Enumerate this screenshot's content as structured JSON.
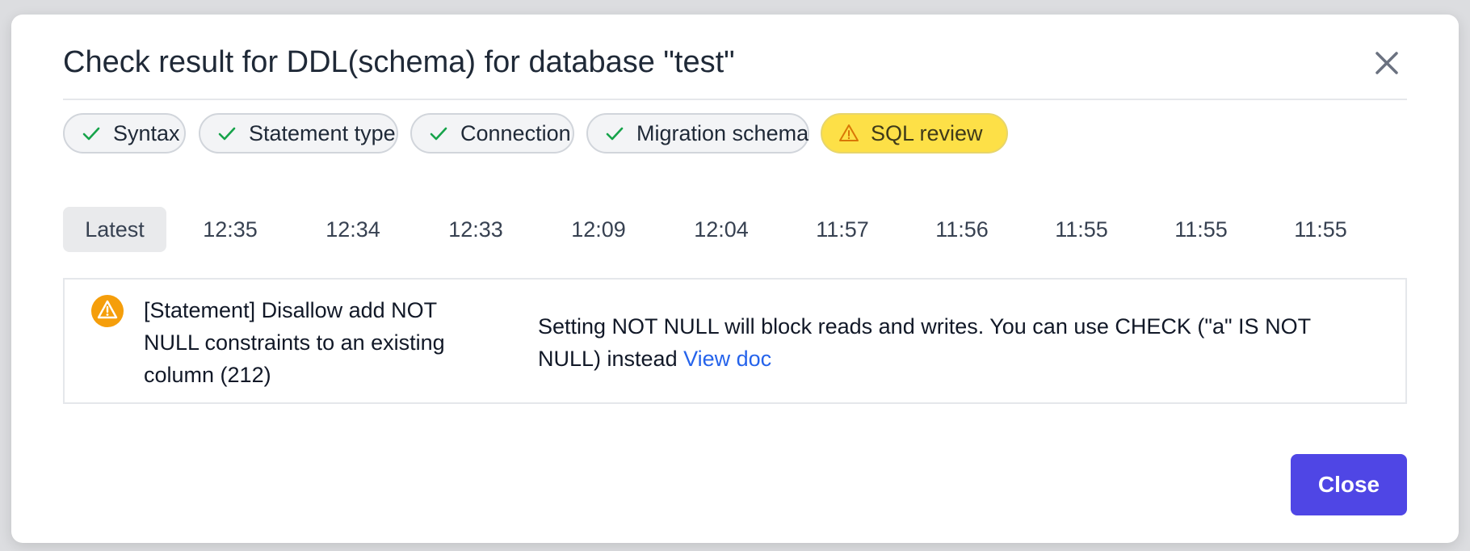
{
  "dialog": {
    "title": "Check result for DDL(schema) for database \"test\"",
    "close_label": "Close"
  },
  "checks": [
    {
      "label": "Syntax",
      "status": "success",
      "icon": "check-icon"
    },
    {
      "label": "Statement type",
      "status": "success",
      "icon": "check-icon"
    },
    {
      "label": "Connection",
      "status": "success",
      "icon": "check-icon"
    },
    {
      "label": "Migration schema",
      "status": "success",
      "icon": "check-icon"
    },
    {
      "label": "SQL review",
      "status": "warning",
      "icon": "warning-triangle-icon"
    }
  ],
  "history_tabs": [
    "Latest",
    "12:35",
    "12:34",
    "12:33",
    "12:09",
    "12:04",
    "11:57",
    "11:56",
    "11:55",
    "11:55",
    "11:55"
  ],
  "active_tab": "Latest",
  "result": {
    "icon": "warning-circle-icon",
    "title": "[Statement] Disallow add NOT NULL constraints to an existing column (212)",
    "message": "Setting NOT NULL will block reads and writes. You can use CHECK (\"a\" IS NOT NULL) instead",
    "link_text": "View doc"
  },
  "colors": {
    "primary": "#4f46e5",
    "success": "#16a34a",
    "warning": "#f59e0b",
    "warning_chip_bg": "#fde047",
    "link": "#2563eb"
  }
}
